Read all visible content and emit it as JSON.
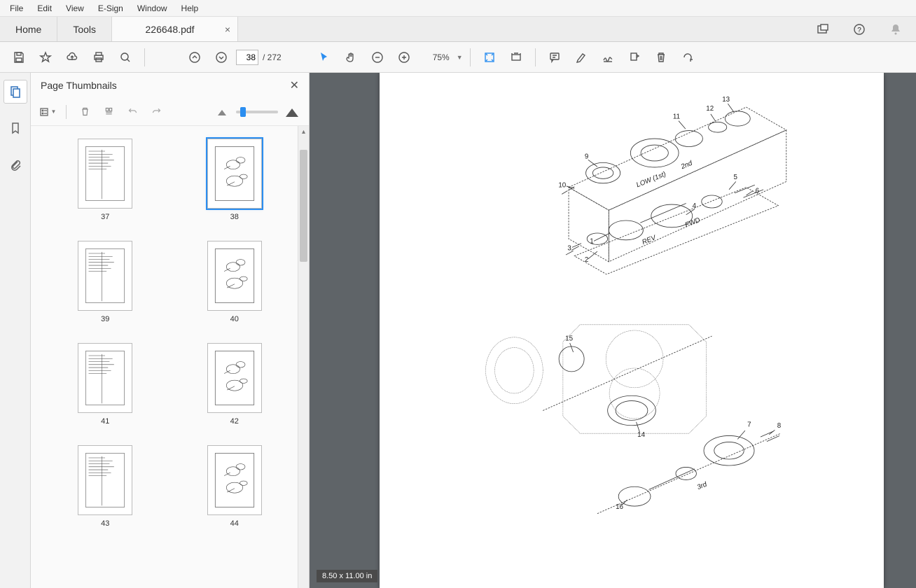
{
  "menu": [
    "File",
    "Edit",
    "View",
    "E-Sign",
    "Window",
    "Help"
  ],
  "tabs": {
    "home": "Home",
    "tools": "Tools",
    "doc": "226648.pdf"
  },
  "toolbar": {
    "page_current": "38",
    "page_total": "/  272",
    "zoom": "75%"
  },
  "thumbs": {
    "title": "Page Thumbnails",
    "pages": [
      "37",
      "38",
      "39",
      "40",
      "41",
      "42",
      "43",
      "44"
    ],
    "selected": "38"
  },
  "page_size": "8.50 x 11.00 in",
  "diagram": {
    "labels": [
      "1",
      "2",
      "3",
      "4",
      "5",
      "6",
      "7",
      "8",
      "9",
      "10",
      "11",
      "12",
      "13",
      "14",
      "15",
      "16"
    ],
    "text": {
      "low": "LOW (1st)",
      "second": "2nd",
      "rev": "REV",
      "fwd": "FWD",
      "third": "3rd"
    }
  }
}
